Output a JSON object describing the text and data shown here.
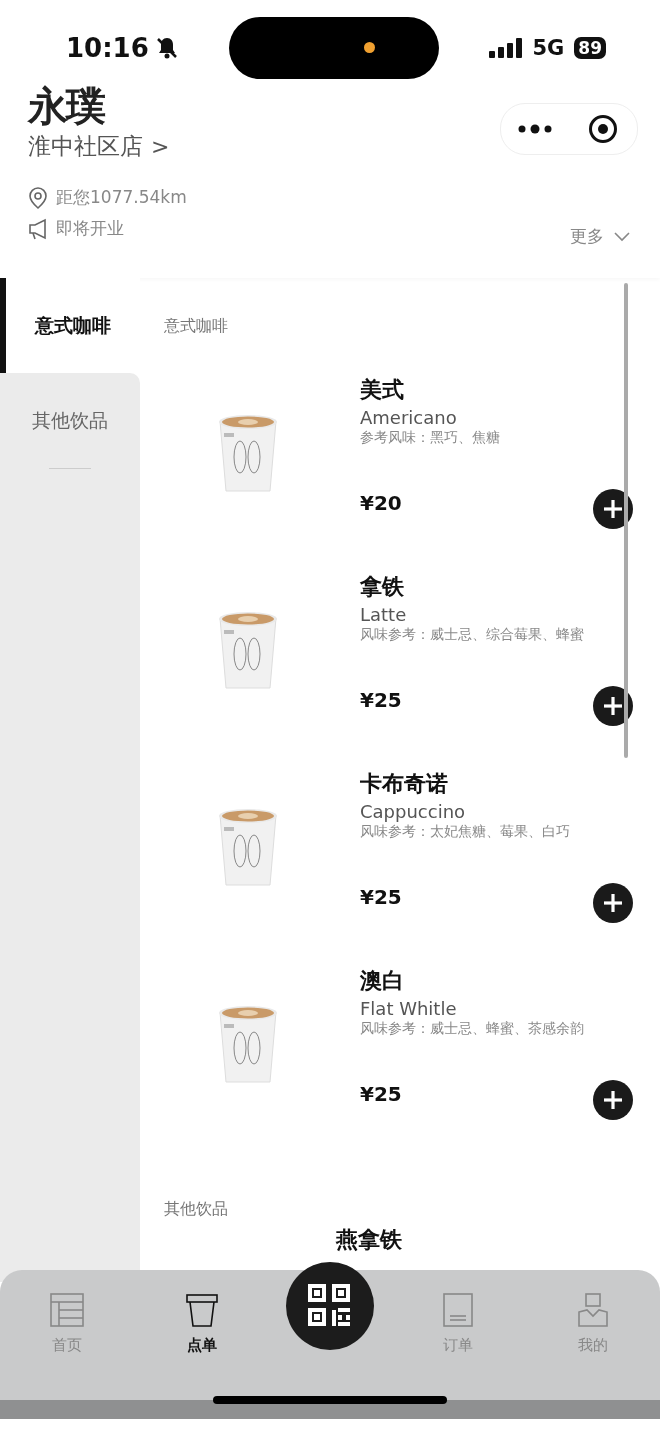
{
  "status_bar": {
    "time": "10:16",
    "network": "5G",
    "battery": "89"
  },
  "store": {
    "logo": "永璞",
    "name": "淮中社区店",
    "chevron": ">",
    "distance": "距您1077.54km",
    "notice": "即将开业",
    "more": "更多"
  },
  "sidebar": {
    "items": [
      {
        "label": "意式咖啡",
        "selected": true
      },
      {
        "label": "其他饮品",
        "selected": false
      }
    ]
  },
  "sections": [
    {
      "title": "意式咖啡",
      "products": [
        {
          "name": "美式",
          "english": "Americano",
          "flavor": "参考风味：黑巧、焦糖",
          "price": "¥20"
        },
        {
          "name": "拿铁",
          "english": "Latte",
          "flavor": "风味参考：威士忌、综合莓果、蜂蜜",
          "price": "¥25"
        },
        {
          "name": "卡布奇诺",
          "english": "Cappuccino",
          "flavor": "风味参考：太妃焦糖、莓果、白巧",
          "price": "¥25"
        },
        {
          "name": "澳白",
          "english": "Flat Whitle",
          "flavor": "风味参考：威士忌、蜂蜜、茶感余韵",
          "price": "¥25"
        }
      ]
    },
    {
      "title": "其他饮品",
      "products": [
        {
          "name": "燕拿铁"
        }
      ]
    }
  ],
  "tab_bar": {
    "items": [
      {
        "kind": "home",
        "label": "首页",
        "selected": false
      },
      {
        "kind": "cup",
        "label": "点单",
        "selected": true
      },
      {
        "kind": "scan",
        "selected": false
      },
      {
        "kind": "orders",
        "label": "订单",
        "selected": false
      },
      {
        "kind": "me",
        "label": "我的",
        "selected": false
      }
    ]
  }
}
